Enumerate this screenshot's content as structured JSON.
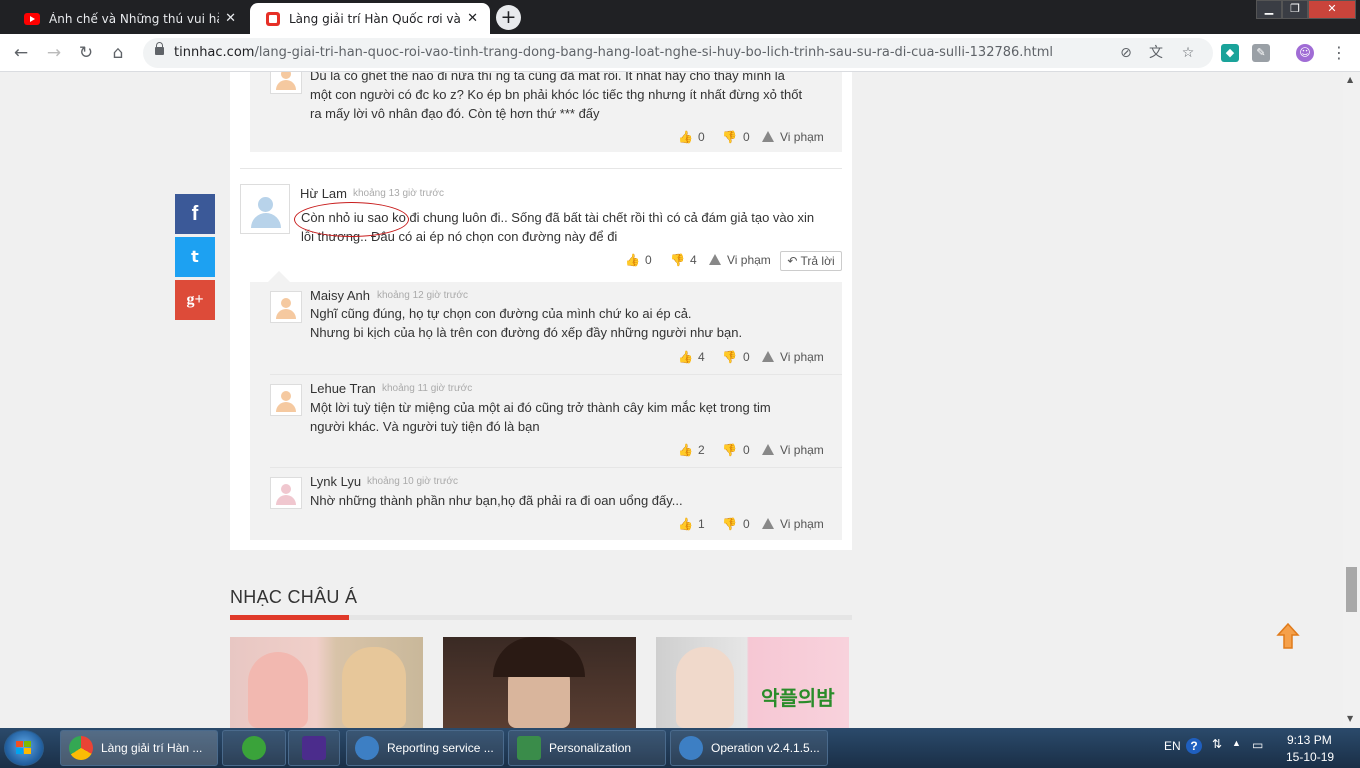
{
  "browser": {
    "tabs": [
      {
        "title": "Ảnh chế và Những thú vui hài hư",
        "close": "✕"
      },
      {
        "title": "Làng giải trí Hàn Quốc rơi vào tìn",
        "close": "✕"
      }
    ],
    "new_tab": "+",
    "url_domain": "tinnhac.com",
    "url_path": "/lang-giai-tri-han-quoc-roi-vao-tinh-trang-dong-bang-hang-loat-nghe-si-huy-bo-lich-trinh-sau-su-ra-di-cua-sulli-132786.html"
  },
  "comments": {
    "top_reply": {
      "text_line1": "Dù là có ghét thế nào đi nữa thì ng ta cũng đã mất rồi. It nhất hãy cho thấy mình là",
      "text_line2": "một con người có đc ko z? Ko ép bn phải khóc lóc tiếc thg nhưng ít nhất đừng xỏ thốt",
      "text_line3": "ra mấy lời vô nhân đạo đó. Còn tệ hơn thứ *** đấy",
      "likes": "0",
      "dislikes": "0",
      "report": "Vi phạm"
    },
    "main": {
      "author": "Hừ Lam",
      "time": "khoảng 13 giờ trước",
      "text_line1": "Còn nhỏ iu sao ko đi chung luôn đi.. Sống đã bất tài chết rồi thì có cả đám giả tạo vào xin",
      "text_line2": "lỗi thương.. Đâu có ai ép nó chọn con đường này để đi",
      "likes": "0",
      "dislikes": "4",
      "report": "Vi phạm",
      "reply": "Trả lời"
    },
    "replies": [
      {
        "author": "Maisy Anh",
        "time": "khoảng 12 giờ trước",
        "text_line1": "Nghĩ cũng đúng, họ tự chọn con đường của mình chứ ko ai ép cả.",
        "text_line2": "Nhưng bi kịch của họ là trên con đường đó xếp đầy những người như bạn.",
        "likes": "4",
        "dislikes": "0",
        "report": "Vi phạm"
      },
      {
        "author": "Lehue Tran",
        "time": "khoảng 11 giờ trước",
        "text_line1": "Một lời tuỳ tiện từ miệng của một ai đó cũng trở thành cây kim mắc kẹt trong tim",
        "text_line2": "người khác. Và người tuỳ tiện đó là bạn",
        "likes": "2",
        "dislikes": "0",
        "report": "Vi phạm"
      },
      {
        "author": "Lynk Lyu",
        "time": "khoảng 10 giờ trước",
        "text_line1": "Nhờ những thành phần như bạn,họ đã phải ra đi oan uổng đấy...",
        "likes": "1",
        "dislikes": "0",
        "report": "Vi phạm"
      }
    ]
  },
  "share": {
    "facebook": "f",
    "twitter": "t",
    "google": "g+"
  },
  "section": {
    "title": "NHẠC CHÂU Á"
  },
  "taskbar": {
    "tasks": [
      "Làng giải trí Hàn ...",
      "Reporting service ...",
      "Personalization",
      "Operation v2.4.1.5..."
    ],
    "lang": "EN",
    "time": "9:13 PM",
    "date": "15-10-19"
  },
  "colors": {
    "accent": "#e03a2a",
    "facebook": "#3b5998",
    "twitter": "#1da1f2",
    "google": "#dd4b39"
  }
}
